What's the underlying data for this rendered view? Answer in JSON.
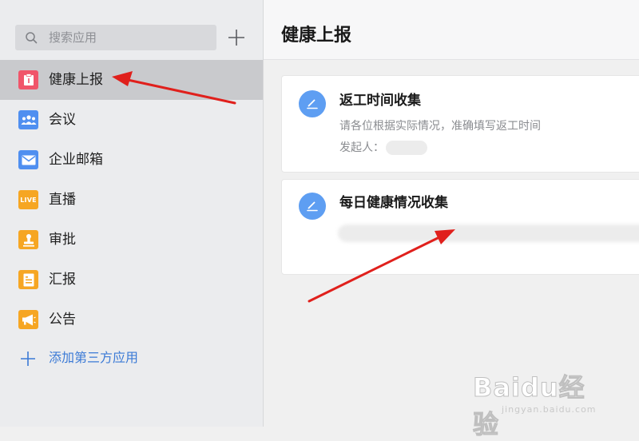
{
  "sidebar": {
    "search": {
      "placeholder": "搜索应用"
    },
    "items": [
      {
        "label": "健康上报",
        "icon": "health-report-icon",
        "color": "#f0556a",
        "active": true
      },
      {
        "label": "会议",
        "icon": "meeting-icon",
        "color": "#4f8ff0"
      },
      {
        "label": "企业邮箱",
        "icon": "mail-icon",
        "color": "#4f8ff0"
      },
      {
        "label": "直播",
        "icon": "live-icon",
        "color": "#f6a623",
        "badge": "LIVE"
      },
      {
        "label": "审批",
        "icon": "approval-stamp-icon",
        "color": "#f6a623"
      },
      {
        "label": "汇报",
        "icon": "report-icon",
        "color": "#f6a623"
      },
      {
        "label": "公告",
        "icon": "megaphone-icon",
        "color": "#f6a623"
      }
    ],
    "add_app_label": "添加第三方应用"
  },
  "main": {
    "title": "健康上报",
    "cards": [
      {
        "title": "返工时间收集",
        "description": "请各位根据实际情况，准确填写返工时间",
        "initiator_label": "发起人："
      },
      {
        "title": "每日健康情况收集"
      }
    ]
  },
  "watermark": {
    "brand": "Baidu经验",
    "url": "jingyan.baidu.com"
  },
  "colors": {
    "accent_blue": "#3b7ad6",
    "card_icon": "#5e9ef2",
    "arrow_red": "#e0201c"
  }
}
